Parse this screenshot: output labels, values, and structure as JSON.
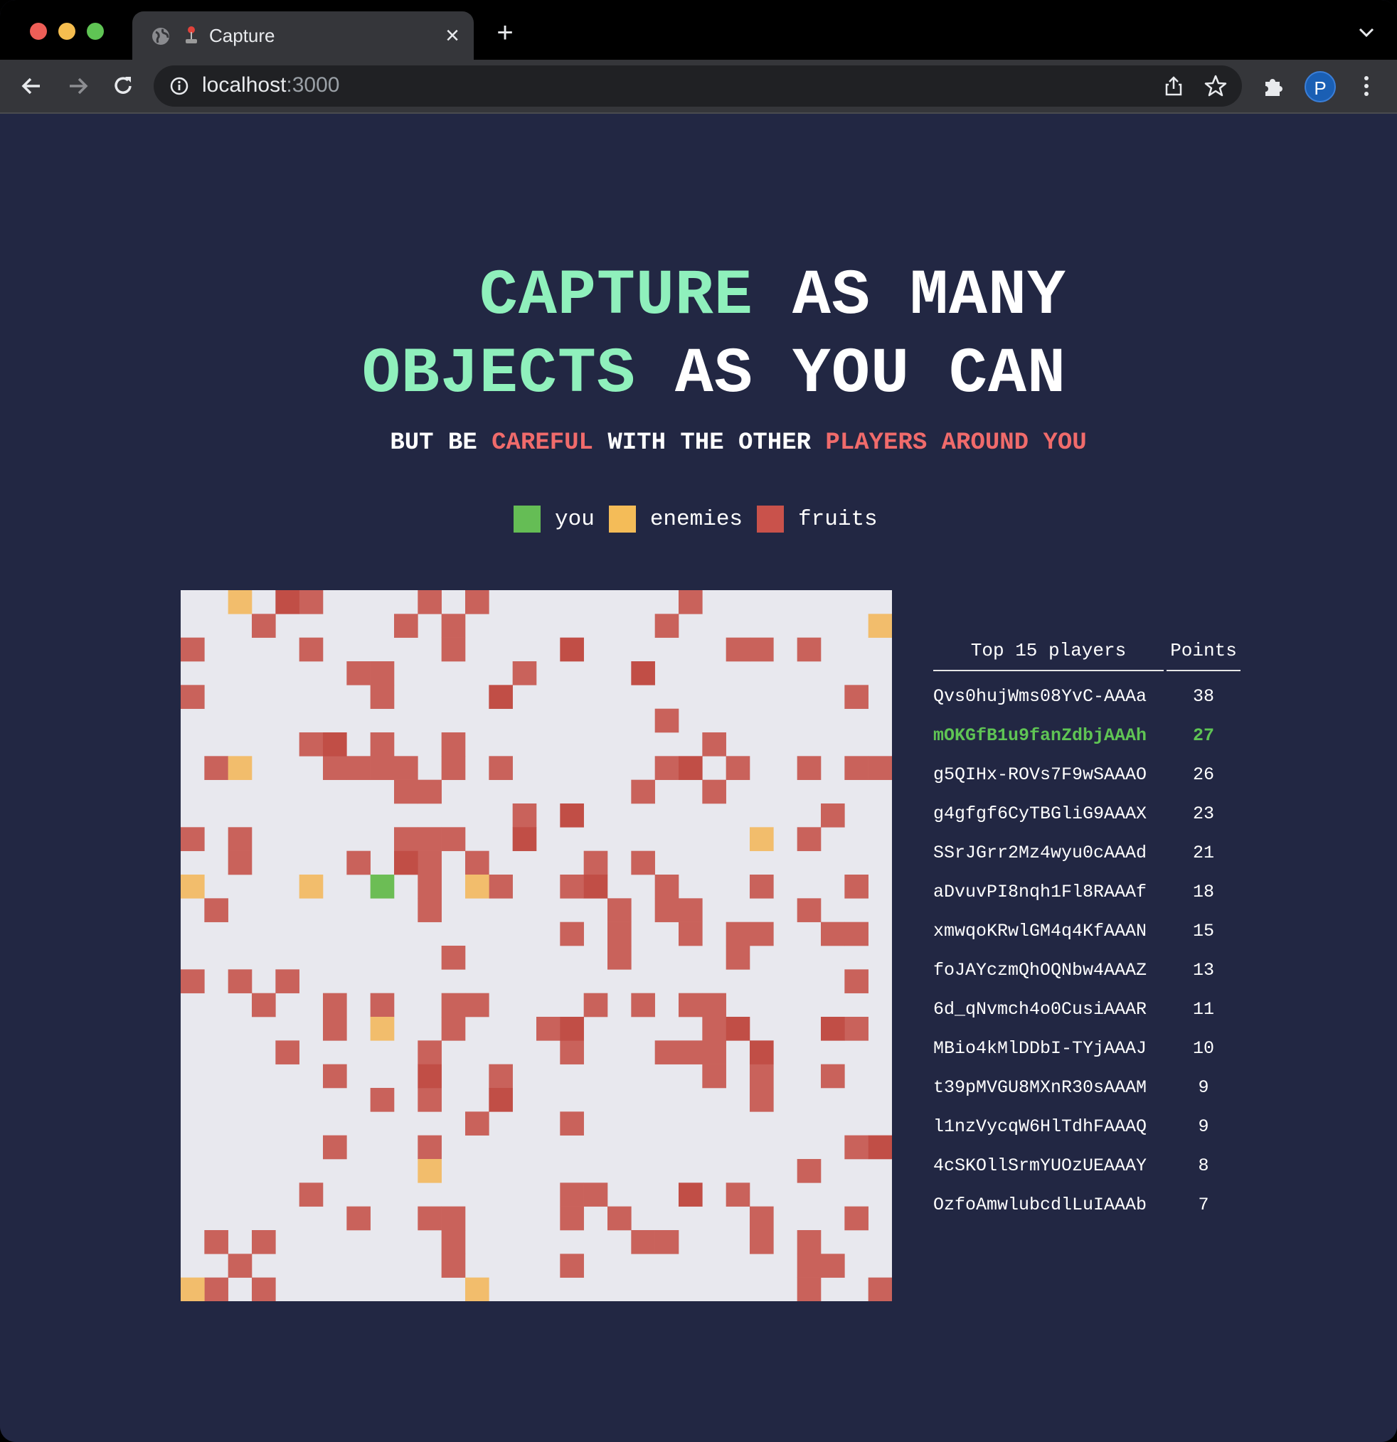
{
  "browser": {
    "tab_title": "Capture",
    "url_host": "localhost",
    "url_port": ":3000",
    "profile_initial": "P"
  },
  "headline": {
    "line1": {
      "accent": "CAPTURE",
      "rest": " AS MANY"
    },
    "line2": {
      "accent": "OBJECTS",
      "rest": " AS YOU CAN"
    }
  },
  "subline": {
    "part1": "BUT BE ",
    "warn1": "CAREFUL",
    "part2": " WITH THE OTHER ",
    "warn2": "PLAYERS AROUND YOU"
  },
  "legend": {
    "you": {
      "label": "you",
      "color": "#65bd55"
    },
    "enemies": {
      "label": "enemies",
      "color": "#f4bc58"
    },
    "fruits": {
      "label": "fruits",
      "color": "#c9524b"
    }
  },
  "board": {
    "cols": 30,
    "rows": 30,
    "background": "#e8e8ee",
    "fruit_color": "#c9625b",
    "fruit_dark_color": "#c14e46",
    "enemy_color": "#f2bd6c",
    "player_color": "#6cbd55",
    "player": [
      [
        8,
        12
      ]
    ],
    "enemies": [
      [
        2,
        0
      ],
      [
        29,
        1
      ],
      [
        2,
        7
      ],
      [
        24,
        10
      ],
      [
        0,
        12
      ],
      [
        5,
        12
      ],
      [
        12,
        12
      ],
      [
        8,
        18
      ],
      [
        10,
        24
      ],
      [
        0,
        29
      ],
      [
        12,
        29
      ]
    ],
    "fruits_dark": [
      [
        4,
        0
      ],
      [
        16,
        2
      ],
      [
        19,
        3
      ],
      [
        13,
        4
      ],
      [
        6,
        6
      ],
      [
        21,
        7
      ],
      [
        16,
        9
      ],
      [
        14,
        10
      ],
      [
        9,
        11
      ],
      [
        17,
        12
      ],
      [
        16,
        18
      ],
      [
        23,
        18
      ],
      [
        27,
        18
      ],
      [
        10,
        20
      ],
      [
        13,
        21
      ],
      [
        24,
        19
      ],
      [
        29,
        23
      ],
      [
        21,
        25
      ]
    ],
    "fruits": [
      [
        5,
        0
      ],
      [
        10,
        0
      ],
      [
        12,
        0
      ],
      [
        21,
        0
      ],
      [
        3,
        1
      ],
      [
        9,
        1
      ],
      [
        11,
        1
      ],
      [
        20,
        1
      ],
      [
        0,
        2
      ],
      [
        5,
        2
      ],
      [
        11,
        2
      ],
      [
        23,
        2
      ],
      [
        24,
        2
      ],
      [
        26,
        2
      ],
      [
        7,
        3
      ],
      [
        8,
        3
      ],
      [
        14,
        3
      ],
      [
        0,
        4
      ],
      [
        8,
        4
      ],
      [
        28,
        4
      ],
      [
        20,
        5
      ],
      [
        5,
        6
      ],
      [
        8,
        6
      ],
      [
        11,
        6
      ],
      [
        22,
        6
      ],
      [
        1,
        7
      ],
      [
        6,
        7
      ],
      [
        7,
        7
      ],
      [
        8,
        7
      ],
      [
        9,
        7
      ],
      [
        11,
        7
      ],
      [
        13,
        7
      ],
      [
        20,
        7
      ],
      [
        23,
        7
      ],
      [
        26,
        7
      ],
      [
        28,
        7
      ],
      [
        29,
        7
      ],
      [
        9,
        8
      ],
      [
        10,
        8
      ],
      [
        19,
        8
      ],
      [
        22,
        8
      ],
      [
        14,
        9
      ],
      [
        27,
        9
      ],
      [
        0,
        10
      ],
      [
        2,
        10
      ],
      [
        9,
        10
      ],
      [
        10,
        10
      ],
      [
        11,
        10
      ],
      [
        26,
        10
      ],
      [
        2,
        11
      ],
      [
        7,
        11
      ],
      [
        10,
        11
      ],
      [
        12,
        11
      ],
      [
        17,
        11
      ],
      [
        19,
        11
      ],
      [
        10,
        12
      ],
      [
        13,
        12
      ],
      [
        16,
        12
      ],
      [
        20,
        12
      ],
      [
        24,
        12
      ],
      [
        28,
        12
      ],
      [
        1,
        13
      ],
      [
        10,
        13
      ],
      [
        18,
        13
      ],
      [
        20,
        13
      ],
      [
        21,
        13
      ],
      [
        26,
        13
      ],
      [
        16,
        14
      ],
      [
        18,
        14
      ],
      [
        21,
        14
      ],
      [
        23,
        14
      ],
      [
        24,
        14
      ],
      [
        27,
        14
      ],
      [
        28,
        14
      ],
      [
        11,
        15
      ],
      [
        18,
        15
      ],
      [
        23,
        15
      ],
      [
        0,
        16
      ],
      [
        2,
        16
      ],
      [
        4,
        16
      ],
      [
        28,
        16
      ],
      [
        3,
        17
      ],
      [
        6,
        17
      ],
      [
        8,
        17
      ],
      [
        11,
        17
      ],
      [
        12,
        17
      ],
      [
        17,
        17
      ],
      [
        19,
        17
      ],
      [
        21,
        17
      ],
      [
        22,
        17
      ],
      [
        6,
        18
      ],
      [
        11,
        18
      ],
      [
        15,
        18
      ],
      [
        22,
        18
      ],
      [
        28,
        18
      ],
      [
        4,
        19
      ],
      [
        10,
        19
      ],
      [
        16,
        19
      ],
      [
        20,
        19
      ],
      [
        21,
        19
      ],
      [
        22,
        19
      ],
      [
        6,
        20
      ],
      [
        13,
        20
      ],
      [
        22,
        20
      ],
      [
        24,
        20
      ],
      [
        27,
        20
      ],
      [
        8,
        21
      ],
      [
        10,
        21
      ],
      [
        24,
        21
      ],
      [
        12,
        22
      ],
      [
        16,
        22
      ],
      [
        6,
        23
      ],
      [
        10,
        23
      ],
      [
        28,
        23
      ],
      [
        26,
        24
      ],
      [
        5,
        25
      ],
      [
        16,
        25
      ],
      [
        17,
        25
      ],
      [
        23,
        25
      ],
      [
        7,
        26
      ],
      [
        10,
        26
      ],
      [
        11,
        26
      ],
      [
        16,
        26
      ],
      [
        18,
        26
      ],
      [
        24,
        26
      ],
      [
        28,
        26
      ],
      [
        1,
        27
      ],
      [
        3,
        27
      ],
      [
        11,
        27
      ],
      [
        19,
        27
      ],
      [
        20,
        27
      ],
      [
        24,
        27
      ],
      [
        26,
        27
      ],
      [
        2,
        28
      ],
      [
        11,
        28
      ],
      [
        16,
        28
      ],
      [
        26,
        28
      ],
      [
        27,
        28
      ],
      [
        1,
        29
      ],
      [
        3,
        29
      ],
      [
        26,
        29
      ],
      [
        29,
        29
      ]
    ]
  },
  "leaderboard": {
    "header_players": "Top 15 players",
    "header_points": "Points",
    "current_player": "mOKGfB1u9fanZdbjAAAh",
    "rows": [
      {
        "name": "Qvs0hujWms08YvC-AAAa",
        "points": "38"
      },
      {
        "name": "mOKGfB1u9fanZdbjAAAh",
        "points": "27"
      },
      {
        "name": "g5QIHx-ROVs7F9wSAAAO",
        "points": "26"
      },
      {
        "name": "g4gfgf6CyTBGliG9AAAX",
        "points": "23"
      },
      {
        "name": "SSrJGrr2Mz4wyu0cAAAd",
        "points": "21"
      },
      {
        "name": "aDvuvPI8nqh1Fl8RAAAf",
        "points": "18"
      },
      {
        "name": "xmwqoKRwlGM4q4KfAAAN",
        "points": "15"
      },
      {
        "name": "foJAYczmQhOQNbw4AAAZ",
        "points": "13"
      },
      {
        "name": "6d_qNvmch4o0CusiAAAR",
        "points": "11"
      },
      {
        "name": "MBio4kMlDDbI-TYjAAAJ",
        "points": "10"
      },
      {
        "name": "t39pMVGU8MXnR30sAAAM",
        "points": "9"
      },
      {
        "name": "l1nzVycqW6HlTdhFAAAQ",
        "points": "9"
      },
      {
        "name": "4cSKOllSrmYUOzUEAAAY",
        "points": "8"
      },
      {
        "name": "OzfoAmwlubcdlLuIAAAb",
        "points": "7"
      }
    ]
  }
}
